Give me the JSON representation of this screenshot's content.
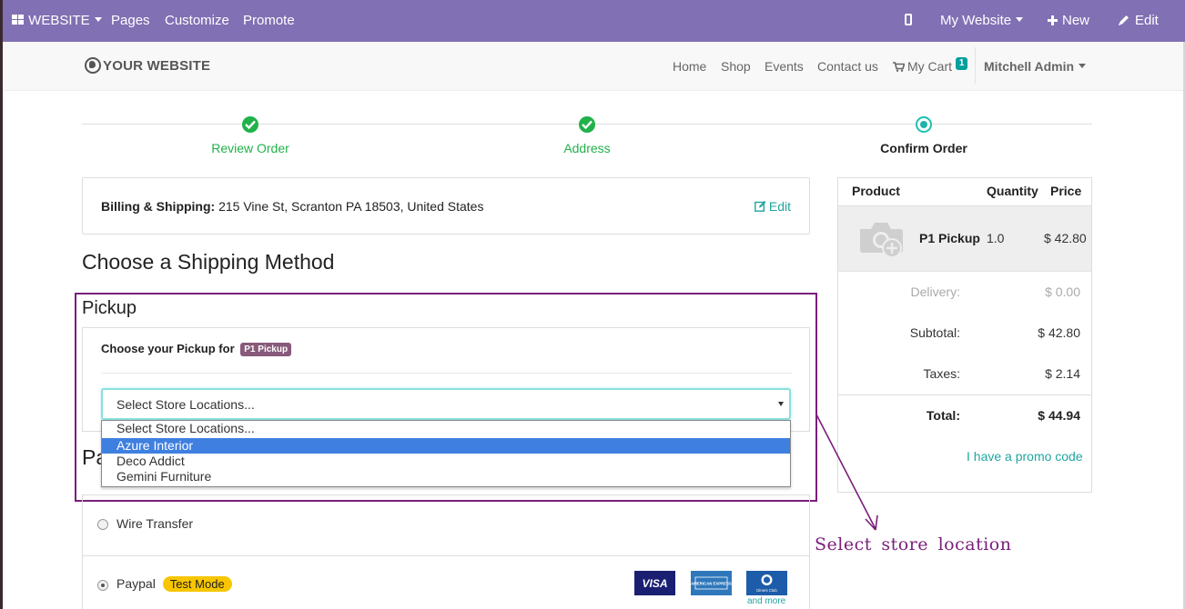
{
  "topbar": {
    "website_label": "WEBSITE",
    "pages": "Pages",
    "customize": "Customize",
    "promote": "Promote",
    "my_website": "My Website",
    "new": "New",
    "edit": "Edit"
  },
  "header": {
    "logo": "YOUR WEBSITE",
    "nav": [
      "Home",
      "Shop",
      "Events",
      "Contact us"
    ],
    "cart_label": "My Cart",
    "cart_count": "1",
    "user": "Mitchell Admin"
  },
  "steps": [
    {
      "label": "Review Order",
      "state": "done"
    },
    {
      "label": "Address",
      "state": "done"
    },
    {
      "label": "Confirm Order",
      "state": "current"
    }
  ],
  "billing": {
    "label": "Billing & Shipping:",
    "address": "215 Vine St, Scranton PA 18503, United States",
    "edit": "Edit"
  },
  "shipping": {
    "heading": "Choose a Shipping Method",
    "method_title": "Pickup",
    "choose_label": "Choose your Pickup for",
    "product_tag": "P1 Pickup",
    "select_value": "Select Store Locations...",
    "options": [
      "Select Store Locations...",
      "Azure Interior",
      "Deco Addict",
      "Gemini Furniture"
    ],
    "highlighted_option": "Azure Interior"
  },
  "payment": {
    "heading_peek": "Pa",
    "methods": [
      {
        "label": "Wire Transfer",
        "selected": false
      },
      {
        "label": "Paypal",
        "selected": true,
        "badge": "Test Mode"
      }
    ],
    "cards": [
      "VISA",
      "AMERICAN EXPRESS",
      "Diners Club"
    ],
    "more": "and more"
  },
  "summary": {
    "headers": {
      "product": "Product",
      "quantity": "Quantity",
      "price": "Price"
    },
    "product": {
      "name": "P1 Pickup",
      "quantity": "1.0",
      "price": "$ 42.80"
    },
    "delivery_label": "Delivery:",
    "delivery_value": "$ 0.00",
    "subtotal_label": "Subtotal:",
    "subtotal_value": "$ 42.80",
    "taxes_label": "Taxes:",
    "taxes_value": "$ 2.14",
    "total_label": "Total:",
    "total_value": "$ 44.94",
    "promo": "I have a promo code"
  },
  "annotation": {
    "text": "Select store location",
    "color": "#7a1e7a"
  },
  "colors": {
    "topbar": "#8170b3",
    "success": "#21b14a",
    "accent": "#20a5a0",
    "selected_option": "#3f7fe0"
  }
}
